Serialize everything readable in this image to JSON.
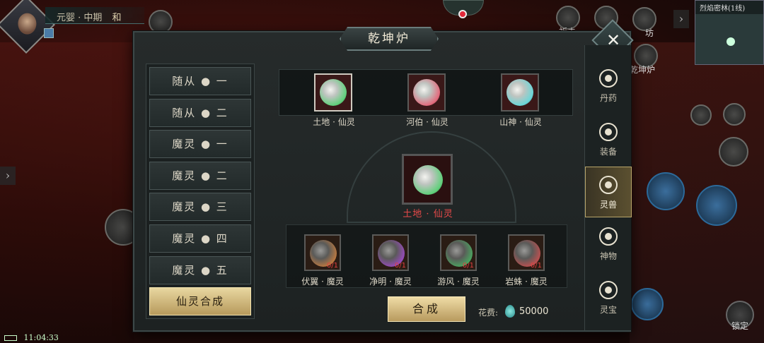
{
  "hud": {
    "player_rank": "元婴 · 中期",
    "player_name_fragment": "和",
    "minimap_title": "烈焰密林(1线)",
    "time": "11:04:33",
    "lock_label": "锁定",
    "side_label_1": "祈未",
    "side_label_2": "坊",
    "side_label_3": "乾坤炉"
  },
  "panel": {
    "title": "乾坤炉",
    "close_icon": "close-icon"
  },
  "list": {
    "items": [
      {
        "label": "随从 ● 一"
      },
      {
        "label": "随从 ● 二"
      },
      {
        "label": "魔灵 ● 一"
      },
      {
        "label": "魔灵 ● 二"
      },
      {
        "label": "魔灵 ● 三"
      },
      {
        "label": "魔灵 ● 四"
      },
      {
        "label": "魔灵 ● 五"
      },
      {
        "label": "仙灵合成"
      }
    ],
    "active_index": 7
  },
  "tabs": [
    {
      "label": "丹药",
      "icon": "mortar-icon"
    },
    {
      "label": "装备",
      "icon": "swords-icon"
    },
    {
      "label": "灵兽",
      "icon": "paw-icon"
    },
    {
      "label": "神物",
      "icon": "fan-icon"
    },
    {
      "label": "灵宝",
      "icon": "spiral-icon"
    }
  ],
  "active_tab": 2,
  "targets": [
    {
      "label": "土地 · 仙灵",
      "color": "#5fd07a"
    },
    {
      "label": "河伯 · 仙灵",
      "color": "#e26a7c"
    },
    {
      "label": "山神 · 仙灵",
      "color": "#6ad6d8"
    }
  ],
  "selected": {
    "label": "土地 · 仙灵",
    "color": "#5fd07a"
  },
  "materials": [
    {
      "label": "伏翼 · 魔灵",
      "count": "0/1",
      "color": "#c07a40"
    },
    {
      "label": "净明 · 魔灵",
      "count": "0/1",
      "color": "#9a4ac0"
    },
    {
      "label": "游风 · 魔灵",
      "count": "0/1",
      "color": "#4aa860"
    },
    {
      "label": "岩蛛 · 魔灵",
      "count": "0/1",
      "color": "#c05050"
    }
  ],
  "action": {
    "synth_label": "合成",
    "cost_label": "花费:",
    "cost_icon": "spirit-crystal-icon",
    "cost_value": "50000"
  }
}
